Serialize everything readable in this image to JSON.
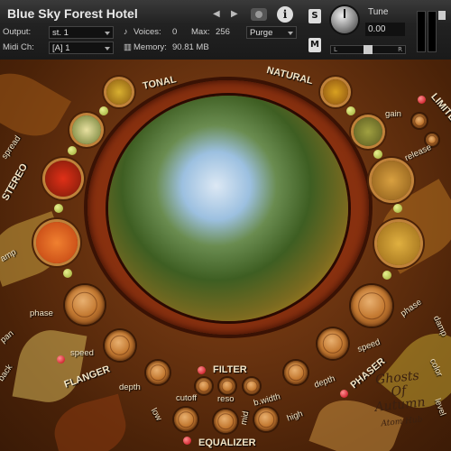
{
  "instrument": {
    "title": "Blue Sky Forest Hotel",
    "nav_prev": "◀",
    "nav_next": "▶",
    "output_label": "Output:",
    "output_value": "st. 1",
    "midi_label": "Midi Ch:",
    "midi_value": "[A] 1",
    "voices_label": "Voices:",
    "voices_value": "0",
    "max_label": "Max:",
    "max_value": "256",
    "memory_label": "Memory:",
    "memory_value": "90.81 MB",
    "purge_label": "Purge",
    "solo_label": "S",
    "mute_label": "M",
    "tune_label": "Tune",
    "tune_value": "0.00",
    "pan_left": "L",
    "pan_right": "R",
    "info_label": "i"
  },
  "panel": {
    "tonal": "TONAL",
    "natural": "NATURAL",
    "limiter": "LIMITER",
    "gain": "gain",
    "release": "release",
    "stereo": "STEREO",
    "spread": "spread",
    "amp": "amp",
    "phase_left": "phase",
    "pan": "pan",
    "back": "back",
    "speed_left": "speed",
    "flanger": "FLANGER",
    "depth_left": "depth",
    "filter": "FILTER",
    "cutoff": "cutoff",
    "reso": "reso",
    "bwidth": "b.width",
    "low": "low",
    "mid": "mid",
    "high": "high",
    "equalizer": "EQUALIZER",
    "phaser": "PHASER",
    "speed_right": "speed",
    "depth_right": "depth",
    "phase_right": "phase",
    "damp": "damp",
    "color": "color",
    "level": "level"
  },
  "signature": {
    "line1": "Ghosts",
    "line2": "Of",
    "line3": "Autumn",
    "sub": "Atom Hub"
  }
}
